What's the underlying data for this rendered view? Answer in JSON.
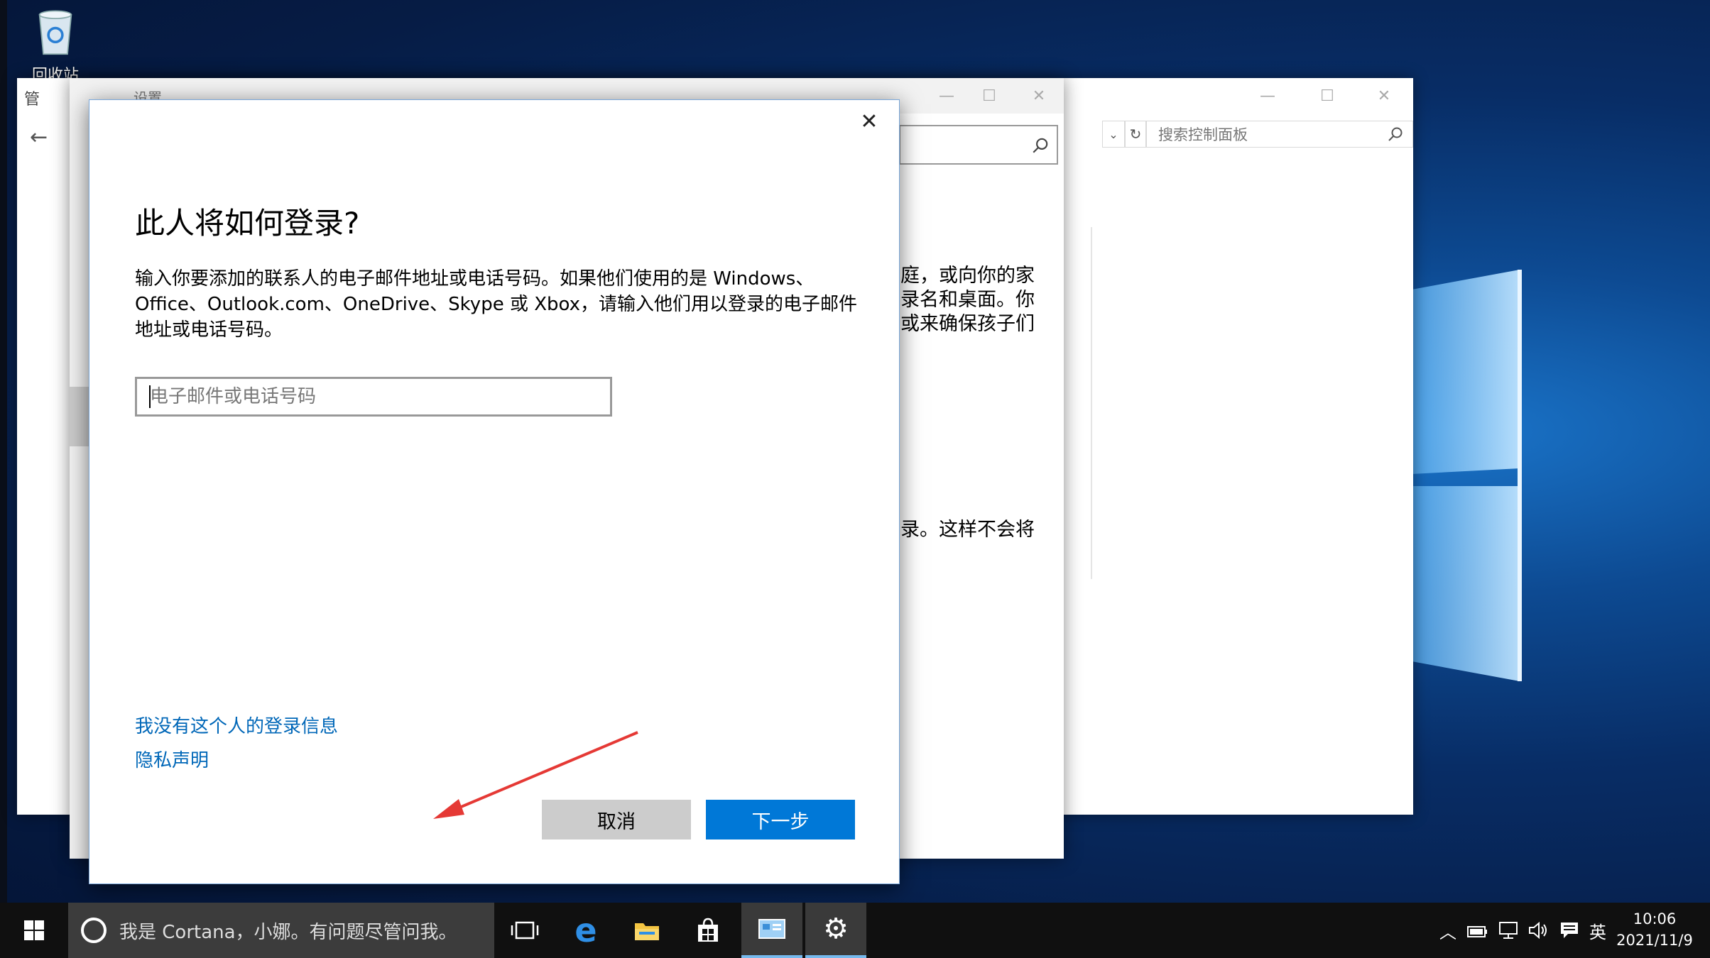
{
  "desktop": {
    "recycle_bin_label": "回收站"
  },
  "control_panel": {
    "title": "管",
    "search_placeholder": "搜索控制面板"
  },
  "settings": {
    "title": "设置",
    "bg_text_1": "庭，或向你的家",
    "bg_text_2": "录名和桌面。你",
    "bg_text_3": "或来确保孩子们",
    "bg_text_4": "录。这样不会将"
  },
  "dialog": {
    "title": "此人将如何登录?",
    "description": "输入你要添加的联系人的电子邮件地址或电话号码。如果他们使用的是 Windows、Office、Outlook.com、OneDrive、Skype 或 Xbox，请输入他们用以登录的电子邮件地址或电话号码。",
    "input_placeholder": "电子邮件或电话号码",
    "link_no_info": "我没有这个人的登录信息",
    "link_privacy": "隐私声明",
    "cancel_label": "取消",
    "next_label": "下一步"
  },
  "taskbar": {
    "cortana_text": "我是 Cortana，小娜。有问题尽管问我。",
    "ime_label": "英",
    "time": "10:06",
    "date": "2021/11/9"
  },
  "colors": {
    "accent": "#0078d7",
    "link": "#0067b8",
    "arrow": "#e53935"
  }
}
